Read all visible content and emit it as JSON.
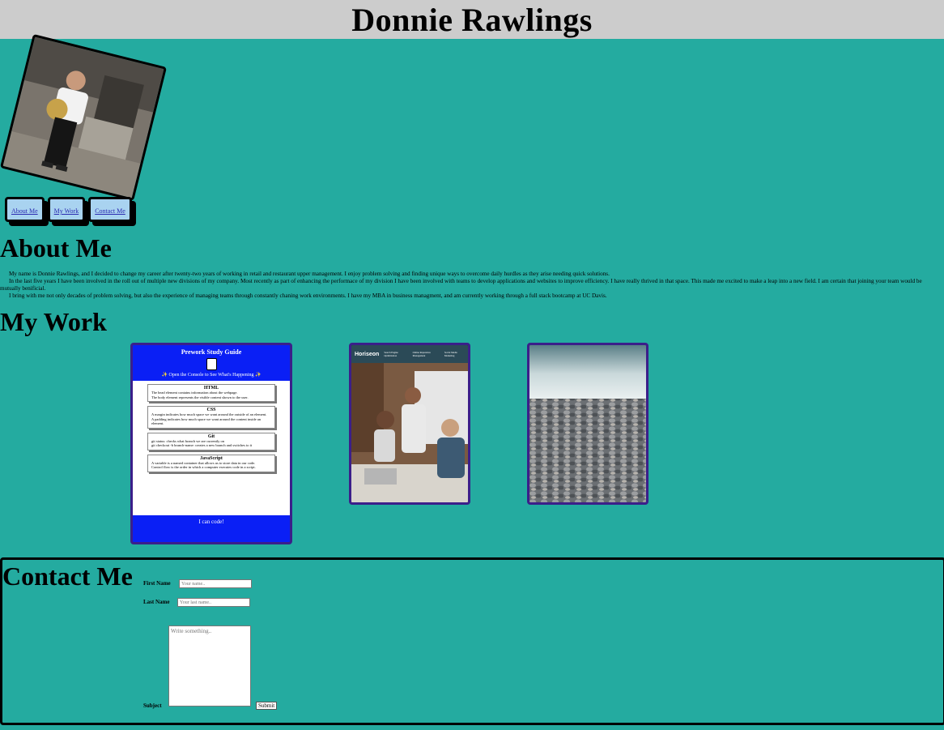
{
  "header": {
    "title": "Donnie Rawlings"
  },
  "nav": {
    "about": "About Me",
    "work": "My Work",
    "contact": "Contact Me"
  },
  "about": {
    "heading": "About Me",
    "paragraphs": [
      "My name is Donnie Rawlings, and I decided to change my career after twenty-two years of working in retail and restaurant upper management. I enjoy problem solving and finding unique ways to overcome daily hurdles as they arise needing quick solutions.",
      "In the last five years I have been involved in the roll out of multiple new divisions of my company. Most recently as part of enhancing the performace of my division I have been involved with teams to develop applications and websites to improve efficiency. I have really thrived in that space. This made me excited to make a leap into a new field. I am certain that joining your team would be mutually benificial.",
      "I bring with me not only decades of problem solving, but also the experience of managing teams through constantly chaning work environments. I have my MBA in business managment, and am currently working through a full stack bootcamp at UC Davis."
    ]
  },
  "work": {
    "heading": "My Work",
    "prework": {
      "title": "Prework Study Guide",
      "console_note": "✨ Open the Console to See What's Happening ✨",
      "sections": [
        {
          "title": "HTML",
          "items": [
            "The head element contains information about the webpage.",
            "The body element represents the visible content shown to the user."
          ]
        },
        {
          "title": "CSS",
          "items": [
            "A margin indicates how much space we want around the outside of an element.",
            "A padding indicates how much space we want around the content inside an element."
          ]
        },
        {
          "title": "Git",
          "items": [
            "git status: checks what branch we are currently on",
            "git checkout -b branch-name: creates a new branch and switches to it"
          ]
        },
        {
          "title": "JavaScript",
          "items": [
            "A variable is a named container that allows us to store data in our code.",
            "Control flow is the order in which a computer executes code in a script."
          ]
        }
      ],
      "footer": "I can code!"
    },
    "horiseon": {
      "brand": "Horiseon",
      "nav": [
        "Search Engine Optimization",
        "Online Reputation Management",
        "Social Media Marketing"
      ]
    }
  },
  "contact": {
    "heading": "Contact Me",
    "first_name_label": "First Name",
    "first_name_placeholder": "Your name..",
    "last_name_label": "Last Name",
    "last_name_placeholder": "Your last name..",
    "subject_label": "Subject",
    "subject_placeholder": "Write something..",
    "submit_label": "Submit"
  },
  "colors": {
    "background": "#24aba0",
    "header": "#cccccc",
    "nav_button": "#a9d3f0",
    "card_border": "#3b1f8a",
    "prework_blue": "#0a1ff5"
  }
}
